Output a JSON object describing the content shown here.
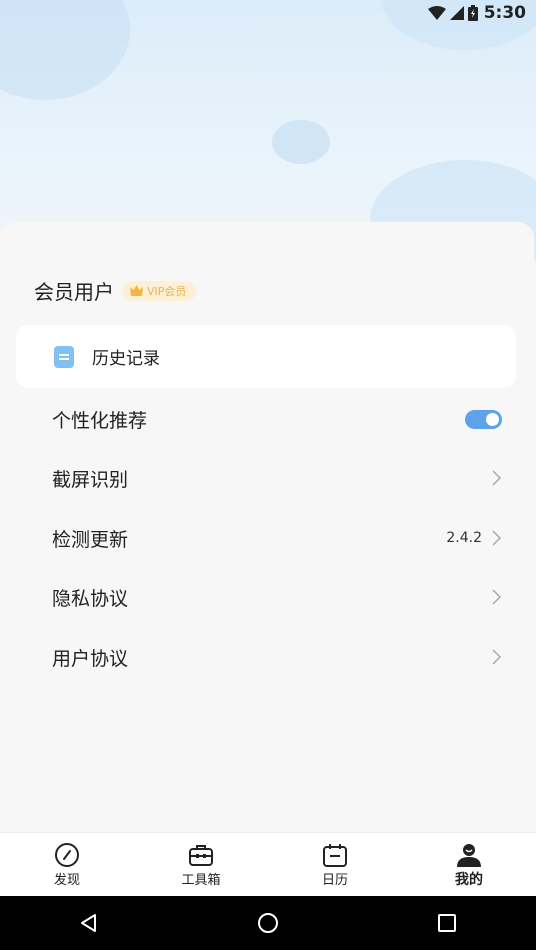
{
  "status_bar": {
    "time": "5:30"
  },
  "profile": {
    "username": "会员用户",
    "vip_badge": "VIP会员"
  },
  "history": {
    "label": "历史记录"
  },
  "settings": [
    {
      "label": "个性化推荐",
      "type": "toggle",
      "on": true
    },
    {
      "label": "截屏识别",
      "type": "link"
    },
    {
      "label": "检测更新",
      "type": "link",
      "value": "2.4.2"
    },
    {
      "label": "隐私协议",
      "type": "link"
    },
    {
      "label": "用户协议",
      "type": "link"
    }
  ],
  "tabs": [
    {
      "label": "发现",
      "icon": "compass-icon"
    },
    {
      "label": "工具箱",
      "icon": "toolbox-icon"
    },
    {
      "label": "日历",
      "icon": "calendar-icon"
    },
    {
      "label": "我的",
      "icon": "user-icon",
      "active": true
    }
  ],
  "colors": {
    "accent": "#5ea3ea",
    "vip": "#e5b555",
    "history_icon": "#7fc1f2"
  }
}
